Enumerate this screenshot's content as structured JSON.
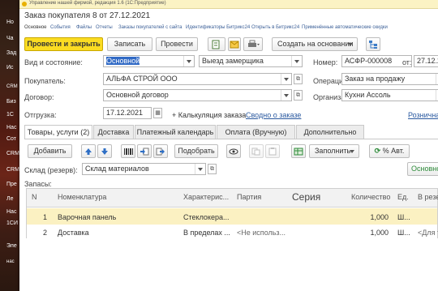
{
  "background": {
    "items": [
      "Но",
      "Ча",
      "Зад",
      "Ис",
      "CRM",
      "Биз",
      "1С",
      "Нас",
      "Сот",
      "СRM",
      "СRM",
      "Пре",
      "Ле",
      "Нас",
      "1СИ",
      "Эле",
      "нас"
    ]
  },
  "window": {
    "title": "Управление нашей фирмой, редакция 1.6  (1С:Предприятие)",
    "doc_title": "Заказ покупателя 8 от 27.12.2021",
    "nav": [
      "Основное",
      "События",
      "Файлы",
      "Отчеты",
      "Заказы покупателей с сайта",
      "Идентификаторы Битрикс24",
      "Открыть в Битрикс24",
      "Применённые автоматические скидки"
    ]
  },
  "toolbar": {
    "post_close": "Провести и закрыть",
    "write": "Записать",
    "post": "Провести",
    "create_based": "Создать на основании"
  },
  "form": {
    "kind_label": "Вид и состояние:",
    "kind_value": "Основной",
    "state_value": "Выезд замерщика",
    "number_label": "Номер:",
    "number_value": "АСФР-000008",
    "from_label": "от:",
    "date_value": "27.12.2",
    "customer_label": "Покупатель:",
    "customer_value": "АЛЬФА СТРОЙ ООО",
    "operation_label": "Операция:",
    "operation_value": "Заказ на продажу",
    "contract_label": "Договор:",
    "contract_value": "Основной договор",
    "org_label": "Организация:",
    "org_value": "Кухни Ассоль",
    "shipment_label": "Отгрузка:",
    "shipment_value": "17.12.2021",
    "calc_link": "+ Калькуляция заказа",
    "info_link": "Сводно о заказе",
    "retail_link": "Розничная"
  },
  "tabs": [
    "Товары, услуги (2)",
    "Доставка",
    "Платежный календарь",
    "Оплата (Вручную)",
    "Дополнительно"
  ],
  "table_toolbar": {
    "add": "Добавить",
    "pick": "Подобрать",
    "fill": "Заполнить",
    "auto": "% Авт."
  },
  "warehouse": {
    "label": "Склад (резерв):",
    "value": "Склад материалов",
    "main_link": "Основно"
  },
  "reserves_label": "Запасы:",
  "table": {
    "headers": [
      "N",
      "Номенклатура",
      "Характерис...",
      "Партия",
      "Серия",
      "Количество",
      "Ед.",
      "В резерв"
    ],
    "rows": [
      {
        "n": "1",
        "item": "Варочная панель",
        "char": "Стеклокера...",
        "batch": "",
        "series": "",
        "qty": "1,000",
        "unit": "Ш...",
        "reserve": ""
      },
      {
        "n": "2",
        "item": "Доставка",
        "char": "В пределах ...",
        "batch": "<Не использ...",
        "series": "",
        "qty": "1,000",
        "unit": "Ш...",
        "reserve": "<Для т..."
      }
    ]
  },
  "colors": {
    "primary_button": "#fbdc22",
    "selected_row": "#fbf1c2",
    "link": "#2b5aa0",
    "accent_green": "#2e8b3a"
  }
}
